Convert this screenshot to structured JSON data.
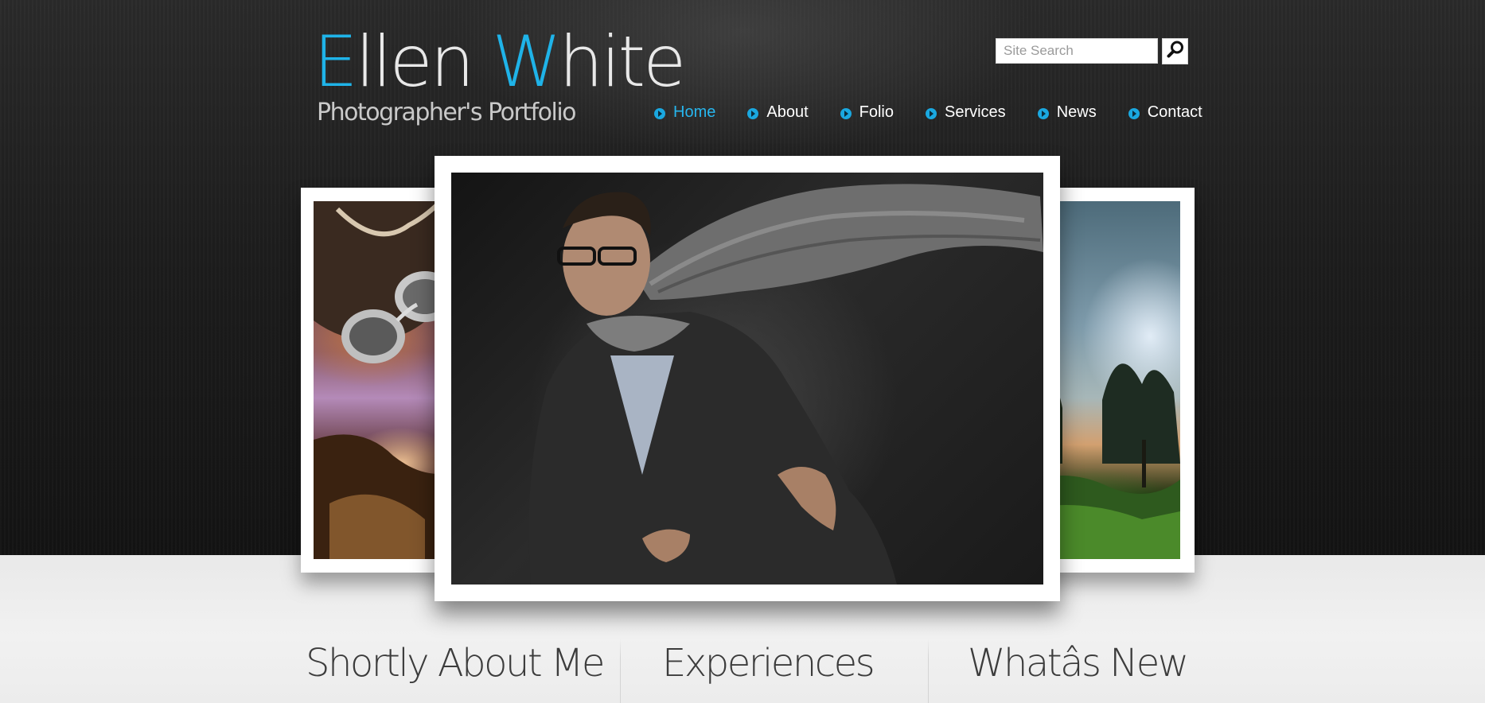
{
  "brand": {
    "title_part1_accent": "E",
    "title_part1": "llen ",
    "title_part2_accent": "W",
    "title_part2": "hite",
    "subtitle": "Photographer's Portfolio"
  },
  "search": {
    "placeholder": "Site Search",
    "button_icon": "search-icon"
  },
  "nav": {
    "items": [
      {
        "label": "Home",
        "active": true
      },
      {
        "label": "About",
        "active": false
      },
      {
        "label": "Folio",
        "active": false
      },
      {
        "label": "Services",
        "active": false
      },
      {
        "label": "News",
        "active": false
      },
      {
        "label": "Contact",
        "active": false
      }
    ],
    "bullet_icon": "arrow-bullet-icon"
  },
  "gallery": {
    "photos": [
      {
        "name": "left-photo"
      },
      {
        "name": "featured-photo"
      },
      {
        "name": "right-photo"
      }
    ]
  },
  "sections": {
    "about_heading": "Shortly About Me",
    "experiences_heading": "Experiences",
    "news_heading": "Whatâs New"
  },
  "colors": {
    "accent": "#1fb3e8",
    "hero_background": "#1d1d1d",
    "content_background": "#ececec"
  }
}
